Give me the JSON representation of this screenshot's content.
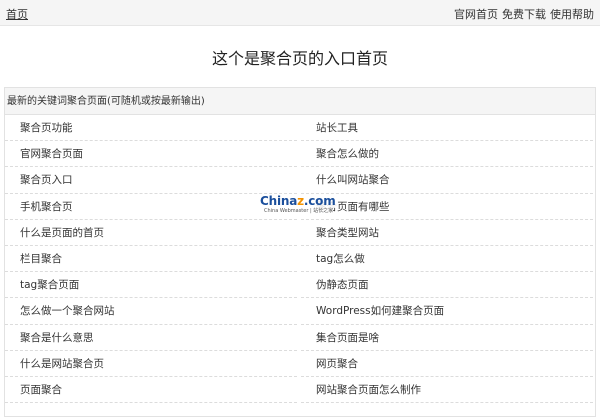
{
  "topbar": {
    "home_label": "首页",
    "links": [
      "官网首页",
      "免费下载",
      "使用帮助"
    ]
  },
  "page": {
    "title": "这个是聚合页的入口首页"
  },
  "panel": {
    "header": "最新的关键词聚合页面(可随机或按最新输出)",
    "left_items": [
      "聚合页功能",
      "官网聚合页面",
      "聚合页入口",
      "手机聚合页",
      "什么是页面的首页",
      "栏目聚合",
      "tag聚合页面",
      "怎么做一个聚合网站",
      "聚合是什么意思",
      "什么是网站聚合页",
      "页面聚合"
    ],
    "right_items": [
      "站长工具",
      "聚合怎么做的",
      "什么叫网站聚合",
      "聚合页面有哪些",
      "聚合类型网站",
      "tag怎么做",
      "伪静态页面",
      "WordPress如何建聚合页面",
      "集合页面是啥",
      "网页聚合",
      "网站聚合页面怎么制作"
    ]
  },
  "watermark": {
    "brand_main": "China",
    "brand_accent": "z",
    "brand_suffix": ".com",
    "tagline": "China Webmaster | 站长之家"
  }
}
